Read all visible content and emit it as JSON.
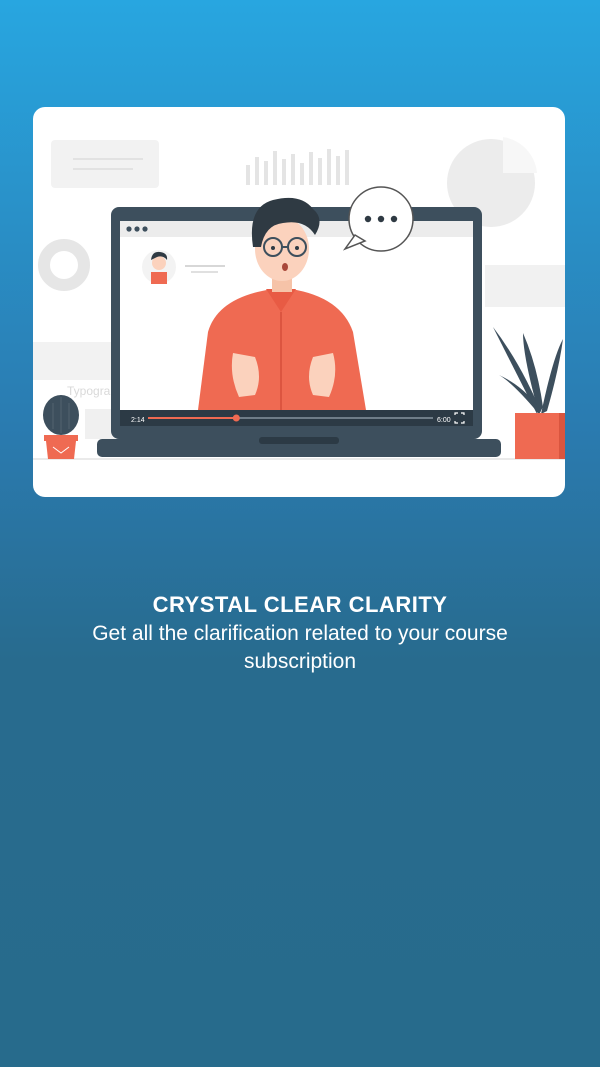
{
  "illustration": {
    "player_time_current": "2:14",
    "player_time_total": "6:00",
    "progress": 0.31,
    "background_word": "Typogra"
  },
  "onboarding": {
    "title": "CRYSTAL CLEAR CLARITY",
    "subtitle": "Get all the clarification related to your course subscription"
  },
  "colors": {
    "accent": "#ef6a52",
    "laptop": "#3d4f5d"
  }
}
